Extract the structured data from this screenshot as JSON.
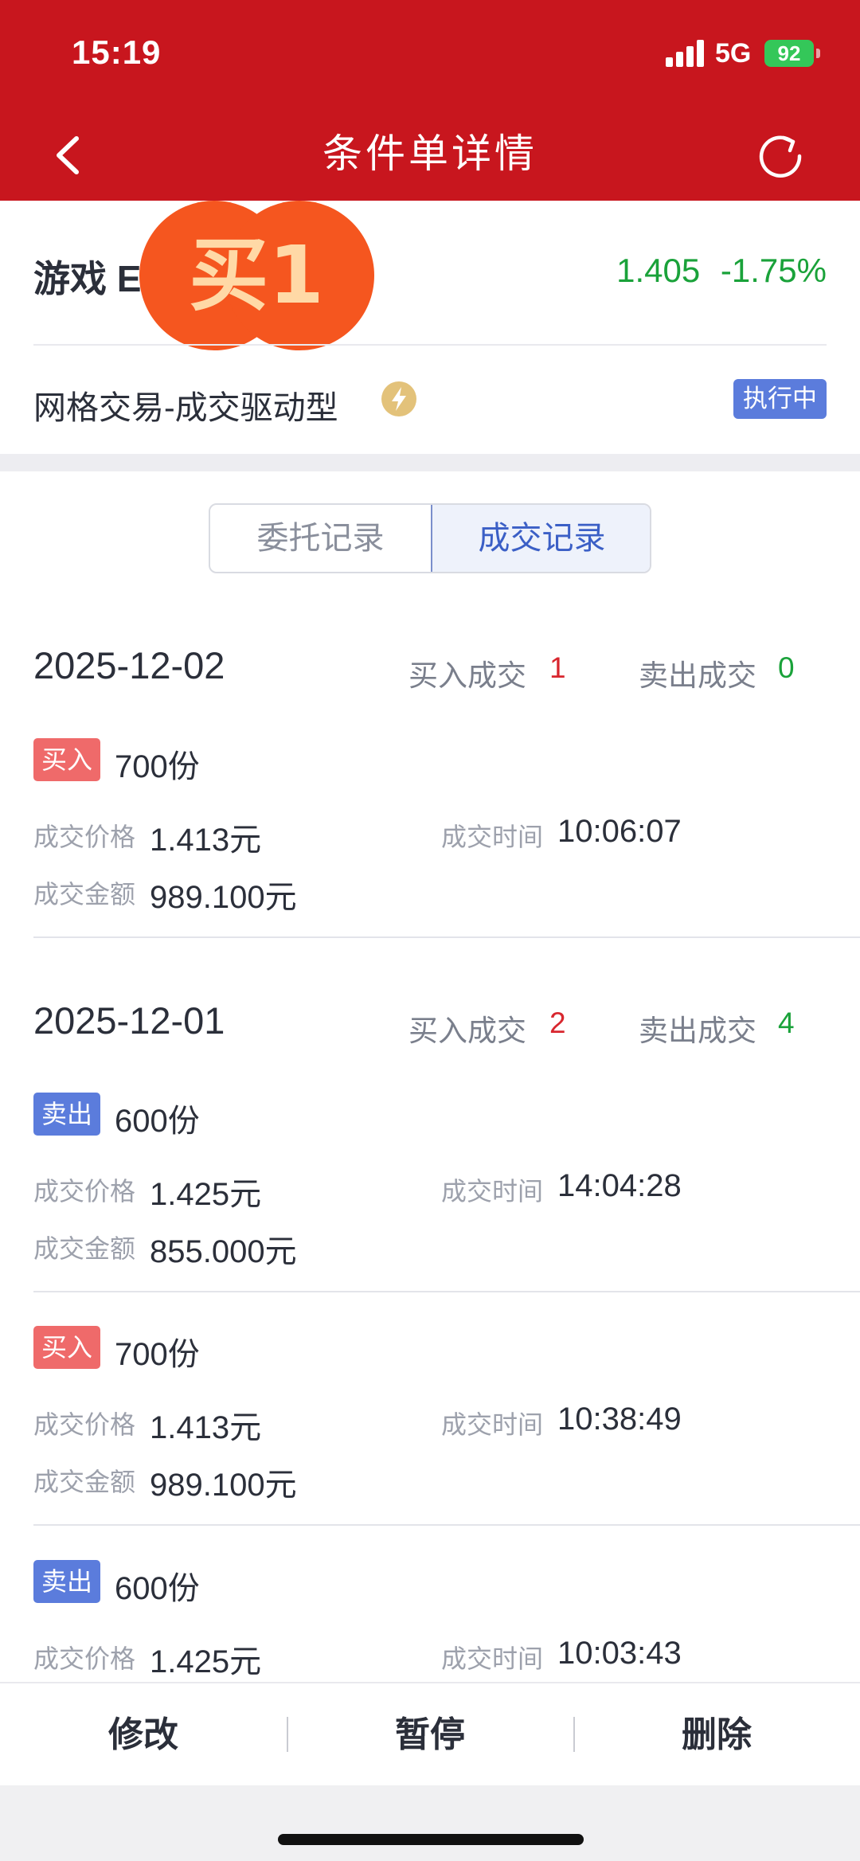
{
  "status_bar": {
    "time": "15:19",
    "network": "5G",
    "battery": "92"
  },
  "nav": {
    "title": "条件单详情"
  },
  "stock": {
    "name": "游戏 E",
    "overlay_badge": "买1",
    "price": "1.405",
    "change": "-1.75%"
  },
  "strategy": {
    "name": "网格交易-成交驱动型",
    "status": "执行中"
  },
  "tabs": [
    "委托记录",
    "成交记录"
  ],
  "labels": {
    "buy_count": "买入成交",
    "sell_count": "卖出成交",
    "price": "成交价格",
    "time": "成交时间",
    "amount": "成交金额"
  },
  "groups": [
    {
      "date": "2025-12-02",
      "buy_count": "1",
      "sell_count": "0",
      "trades": [
        {
          "side": "买入",
          "qty": "700份",
          "price": "1.413元",
          "time": "10:06:07",
          "amount": "989.100元"
        }
      ]
    },
    {
      "date": "2025-12-01",
      "buy_count": "2",
      "sell_count": "4",
      "trades": [
        {
          "side": "卖出",
          "qty": "600份",
          "price": "1.425元",
          "time": "14:04:28",
          "amount": "855.000元"
        },
        {
          "side": "买入",
          "qty": "700份",
          "price": "1.413元",
          "time": "10:38:49",
          "amount": "989.100元"
        },
        {
          "side": "卖出",
          "qty": "600份",
          "price": "1.425元",
          "time": "10:03:43"
        }
      ]
    }
  ],
  "bottom_actions": [
    "修改",
    "暂停",
    "删除"
  ],
  "colors": {
    "brand_red": "#c8161e",
    "up_red": "#d8262e",
    "down_green": "#1aa23a",
    "accent_blue": "#5b7cdc"
  }
}
